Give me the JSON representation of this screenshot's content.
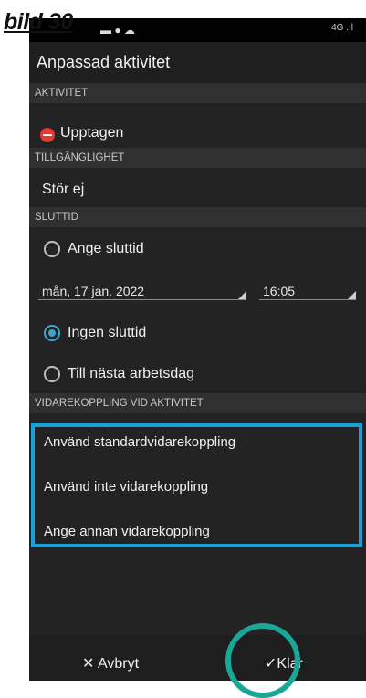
{
  "caption": "bild 30",
  "status_bar": {
    "right": "4G .ıl"
  },
  "header": {
    "title": "Anpassad aktivitet"
  },
  "sections": {
    "aktivitet": {
      "label": "AKTIVITET",
      "value": "Upptagen",
      "status_color": "#e53935"
    },
    "tillganglighet": {
      "label": "TILLGÄNGLIGHET",
      "value": "Stör ej"
    },
    "sluttid": {
      "label": "SLUTTID",
      "options": [
        {
          "label": "Ange sluttid",
          "selected": false
        },
        {
          "label": "Ingen sluttid",
          "selected": true
        },
        {
          "label": "Till nästa arbetsdag",
          "selected": false
        }
      ],
      "date": "mån, 17 jan. 2022",
      "time": "16:05"
    },
    "vidarekoppling": {
      "label": "VIDAREKOPPLING VID AKTIVITET",
      "options": [
        "Använd standardvidarekoppling",
        "Använd inte vidarekoppling",
        "Ange annan vidarekoppling"
      ]
    }
  },
  "footer": {
    "cancel": "Avbryt",
    "done": "Klar"
  },
  "colors": {
    "highlight": "#1aa0d8",
    "circle": "#1aa797",
    "radio_selected": "#3fa4c9"
  }
}
